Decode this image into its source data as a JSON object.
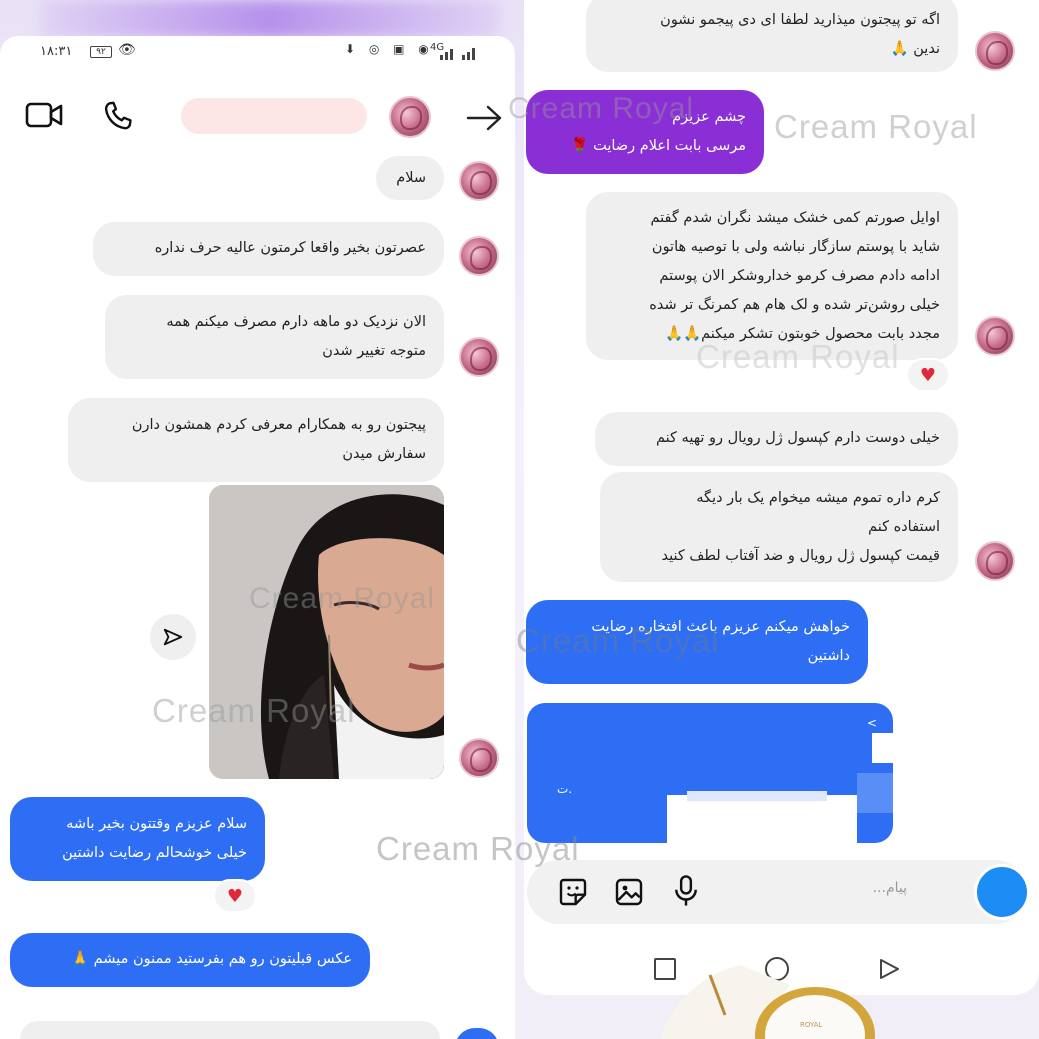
{
  "status_bar": {
    "time": "۱۸:۳۱",
    "battery": "۹۲",
    "signal_text": "4G"
  },
  "header": {
    "icons": [
      "video-icon",
      "phone-icon",
      "arrow-right-icon"
    ]
  },
  "left_messages": [
    {
      "text": "سلام"
    },
    {
      "text": "عصرتون بخیر واقعا کرمتون عالیه حرف نداره"
    },
    {
      "text": "الان نزدیک دو ماهه دارم مصرف میکنم همه\nمتوجه تغییر شدن"
    },
    {
      "text": "پیجتون رو به همکارام معرفی کردم همشون دارن\nسفارش میدن"
    }
  ],
  "left_outgoing": [
    {
      "text": "سلام عزیزم وقتتون بخیر باشه\nخیلی خوشحالم رضایت داشتین"
    },
    {
      "text": "عکس قبلیتون رو هم بفرستید ممنون میشم 🙏"
    }
  ],
  "right_messages": [
    {
      "text": "اگه تو پیجتون میذارید لطفا ای دی پیجمو نشون\nندین 🙏"
    },
    {
      "text": "اوایل صورتم کمی خشک میشد نگران شدم گفتم\nشاید با پوستم سازگار نباشه ولی با توصیه هاتون\nادامه دادم مصرف کرمو خداروشکر الان پوستم\nخیلی روشن‌تر شده و لک هام هم کمرنگ تر شده\nمجدد بابت محصول خوبتون تشکر میکنم🙏🙏"
    },
    {
      "text": "خیلی دوست دارم کپسول ژل رویال رو تهیه کنم"
    },
    {
      "text": "کرم داره تموم میشه میخوام یک بار دیگه\nاستفاده کنم\nقیمت کپسول ژل رویال و ضد آفتاب لطف کنید"
    }
  ],
  "right_outgoing": [
    {
      "text": "چشم عزیزم\nمرسی بابت اعلام رضایت 🌹"
    },
    {
      "text": "خواهش میکنم عزیزم باعث افتخاره رضایت\nداشتین"
    }
  ],
  "composer": {
    "placeholder": "پیام..."
  },
  "watermark": "Cream Royal",
  "colors": {
    "blue_bubble": "#2d6ef5",
    "purple_bubble": "#8a2fd6",
    "gray_bubble": "#efefef",
    "heart": "#e0283b"
  }
}
